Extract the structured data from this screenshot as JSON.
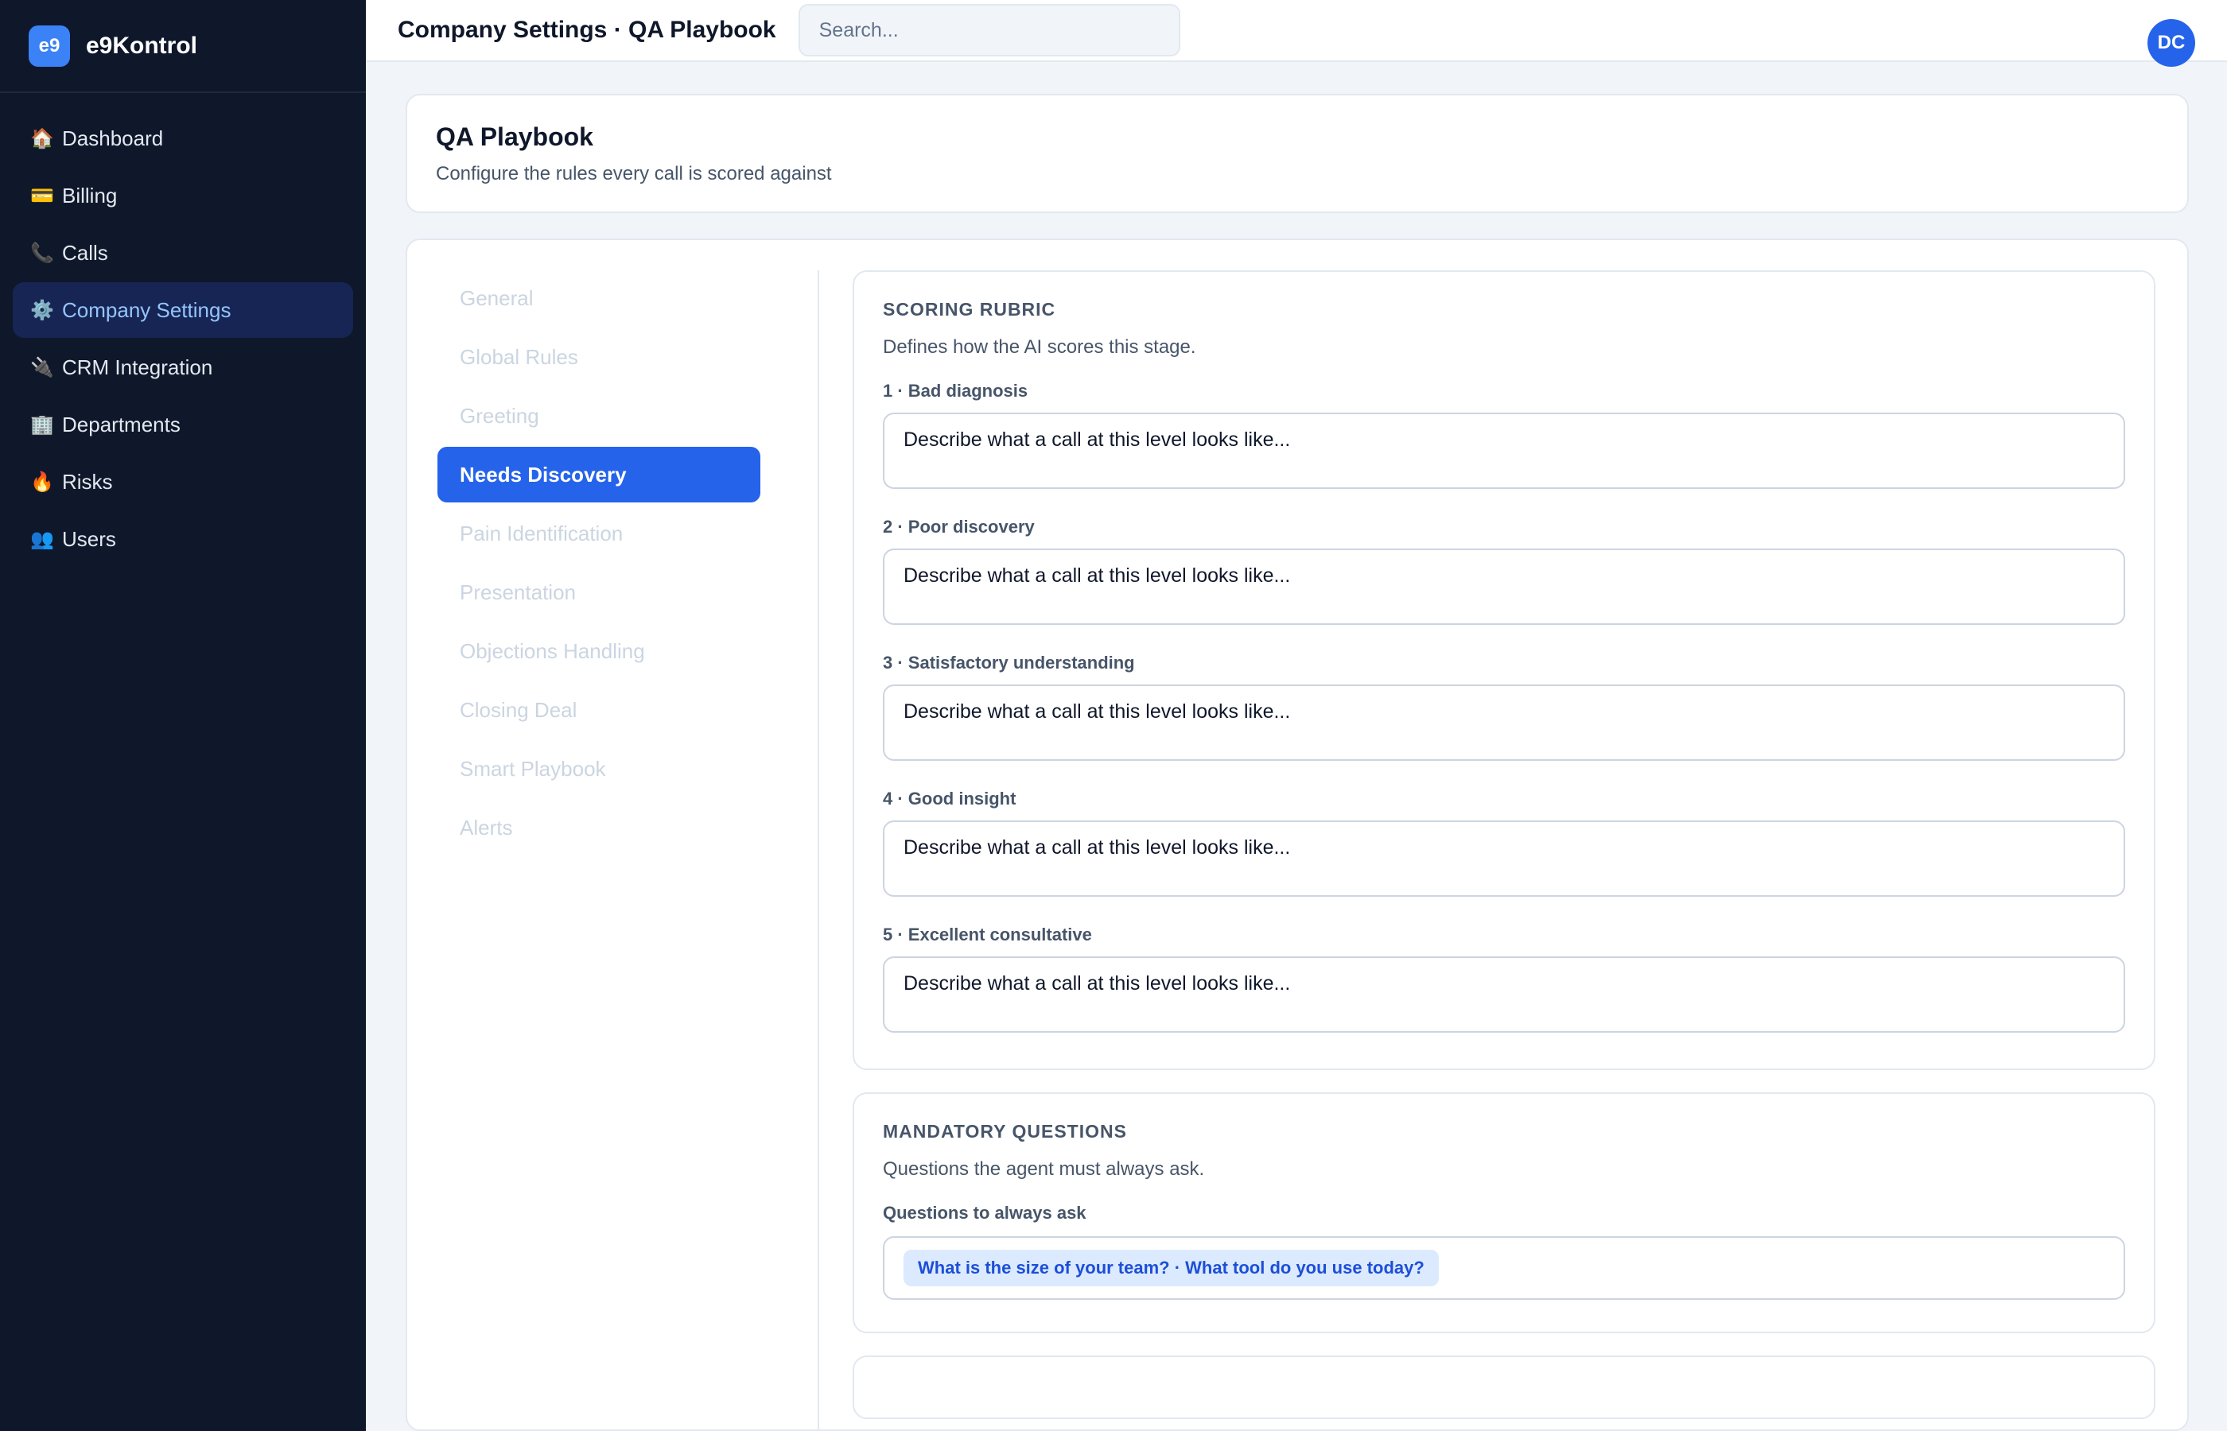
{
  "brand": {
    "logo": "e9",
    "name": "e9Kontrol"
  },
  "sidebar": {
    "items": [
      {
        "icon": "🏠",
        "icon_name": "house-icon",
        "label": "Dashboard"
      },
      {
        "icon": "💳",
        "icon_name": "credit-card-icon",
        "label": "Billing"
      },
      {
        "icon": "📞",
        "icon_name": "phone-icon",
        "label": "Calls"
      },
      {
        "icon": "⚙️",
        "icon_name": "gear-icon",
        "label": "Company Settings",
        "active": true
      },
      {
        "icon": "🔌",
        "icon_name": "plug-icon",
        "label": "CRM Integration"
      },
      {
        "icon": "🏢",
        "icon_name": "building-icon",
        "label": "Departments"
      },
      {
        "icon": "🔥",
        "icon_name": "fire-icon",
        "label": "Risks"
      },
      {
        "icon": "👥",
        "icon_name": "users-icon",
        "label": "Users"
      }
    ]
  },
  "topbar": {
    "title": "Company Settings · QA Playbook",
    "search_placeholder": "Search...",
    "avatar_initials": "DC"
  },
  "page": {
    "title": "QA Playbook",
    "subtitle": "Configure the rules every call is scored against"
  },
  "stages": [
    {
      "label": "General"
    },
    {
      "label": "Global Rules"
    },
    {
      "label": "Greeting"
    },
    {
      "label": "Needs Discovery",
      "active": true
    },
    {
      "label": "Pain Identification"
    },
    {
      "label": "Presentation"
    },
    {
      "label": "Objections Handling"
    },
    {
      "label": "Closing Deal"
    },
    {
      "label": "Smart Playbook"
    },
    {
      "label": "Alerts"
    }
  ],
  "scoring_rubric": {
    "title": "SCORING RUBRIC",
    "description": "Defines how the AI scores this stage.",
    "levels": [
      {
        "label": "1 · Bad diagnosis",
        "placeholder": "Describe what a call at this level looks like..."
      },
      {
        "label": "2 · Poor discovery",
        "placeholder": "Describe what a call at this level looks like..."
      },
      {
        "label": "3 · Satisfactory understanding",
        "placeholder": "Describe what a call at this level looks like..."
      },
      {
        "label": "4 · Good insight",
        "placeholder": "Describe what a call at this level looks like..."
      },
      {
        "label": "5 · Excellent consultative",
        "placeholder": "Describe what a call at this level looks like..."
      }
    ]
  },
  "mandatory_questions": {
    "title": "MANDATORY QUESTIONS",
    "description": "Questions the agent must always ask.",
    "field_label": "Questions to always ask",
    "tag": "What is the size of your team? · What tool do you use today?"
  },
  "colors": {
    "sidebar_bg": "#0f172a",
    "accent": "#2563eb",
    "active_nav_bg": "#172554",
    "active_nav_text": "#93c5fd",
    "tag_bg": "#dbeafe",
    "tag_text": "#1d4ed8"
  }
}
